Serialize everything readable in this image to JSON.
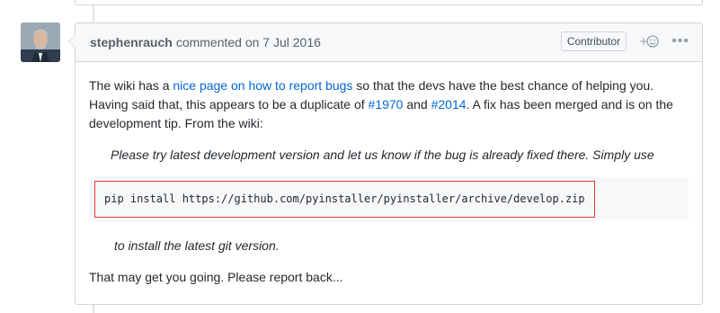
{
  "comment": {
    "author": "stephenrauch",
    "action": "commented on 7 Jul 2016",
    "role_badge": "Contributor",
    "reaction_icon": "smiley-plus-icon",
    "menu_icon": "kebab-menu-icon",
    "body": {
      "p1_text1": "The wiki has a ",
      "p1_link1": "nice page on how to report bugs",
      "p1_text2": " so that the devs have the best chance of helping you. Having said that, this appears to be a duplicate of ",
      "p1_link2": "#1970",
      "p1_text3": " and ",
      "p1_link3": "#2014",
      "p1_text4": ". A fix has been merged and is on the development tip. From the wiki:",
      "quote": "Please try latest development version and let us know if the bug is already fixed there. Simply use",
      "code": "pip install https://github.com/pyinstaller/pyinstaller/archive/develop.zip",
      "quote2": "to install the latest git version.",
      "closing": "That may get you going. Please report back..."
    }
  }
}
